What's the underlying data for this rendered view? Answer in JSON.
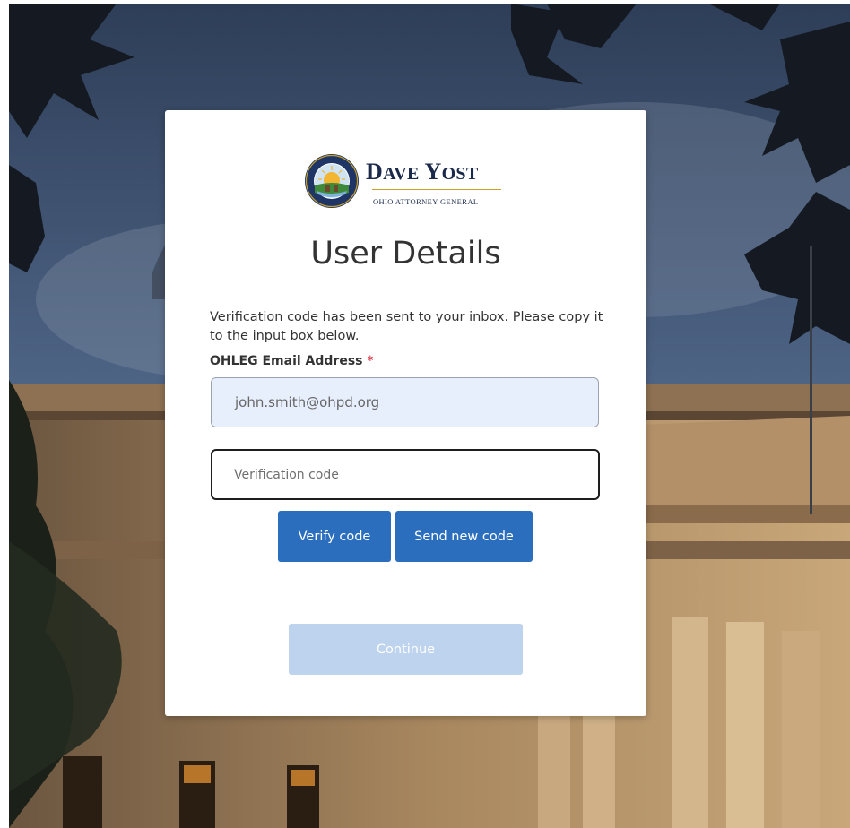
{
  "logo": {
    "name_first_initial": "D",
    "name_first_rest": "AVE",
    "name_last_initial": "Y",
    "name_last_rest": "OST",
    "subtitle": "Ohio Attorney General",
    "seal_text": "ATTORNEY GENERAL OF OHIO",
    "colors": {
      "navy": "#1b2a4a",
      "gold": "#c9a227"
    }
  },
  "page": {
    "title": "User Details",
    "intro": "Verification code has been sent to your inbox. Please copy it to the input box below."
  },
  "form": {
    "email_label": "OHLEG Email Address",
    "required_marker": "*",
    "email_value": "john.smith@ohpd.org",
    "code_placeholder": "Verification code",
    "code_value": ""
  },
  "buttons": {
    "verify_label": "Verify code",
    "send_new_label": "Send new code",
    "continue_label": "Continue",
    "continue_enabled": false
  },
  "colors": {
    "primary": "#2a6ebd",
    "disabled": "#bed3ee",
    "required": "#d0021b",
    "input_autofill": "#e8effc"
  }
}
